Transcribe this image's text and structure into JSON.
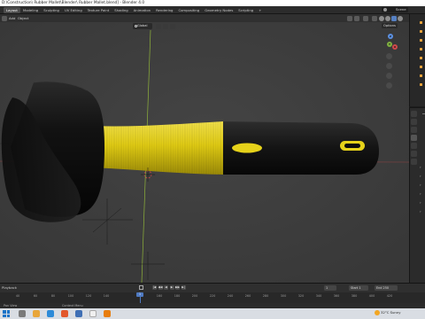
{
  "window": {
    "title": "D:\\Construction\\ Rubber Mallet\\Blender\\ Rubber Mallet.blend] - Blender 4.0"
  },
  "topbar": {
    "tabs": [
      "Layout",
      "Modeling",
      "Sculpting",
      "UV Editing",
      "Texture Paint",
      "Shading",
      "Animation",
      "Rendering",
      "Compositing",
      "Geometry Nodes",
      "Scripting",
      "+"
    ],
    "active_tab": "Layout",
    "scene_label": "Scene"
  },
  "viewport": {
    "menus": [
      "Add",
      "Object"
    ],
    "orientation": "Global",
    "options_label": "Options",
    "gizmo": {
      "y_axis": "Y",
      "z_axis": "Z",
      "x_axis": "X"
    }
  },
  "timeline": {
    "playback_label": "Playback",
    "current_frame": "1",
    "start_label": "Start",
    "start_value": "1",
    "end_label": "End",
    "end_value": "250",
    "ticks": [
      "40",
      "60",
      "80",
      "100",
      "120",
      "140",
      "160",
      "180",
      "200",
      "220",
      "240",
      "260",
      "280",
      "300",
      "320",
      "340",
      "360",
      "380",
      "400",
      "420"
    ],
    "playhead": "1",
    "buttons": [
      "|◀",
      "◀◀",
      "◀",
      "▶",
      "▶▶",
      "▶|"
    ]
  },
  "statusbar": {
    "left": "Pan View",
    "middle": "Context Menu"
  },
  "taskbar": {
    "weather": "32°C",
    "weather_sub": "Sunny"
  },
  "colors": {
    "handle_yellow": "#e8d41f",
    "mallet_black": "#141414",
    "grid_x_axis": "#a24545",
    "grid_y_axis": "#8fb33a",
    "accent_blue": "#4f7ac2"
  }
}
